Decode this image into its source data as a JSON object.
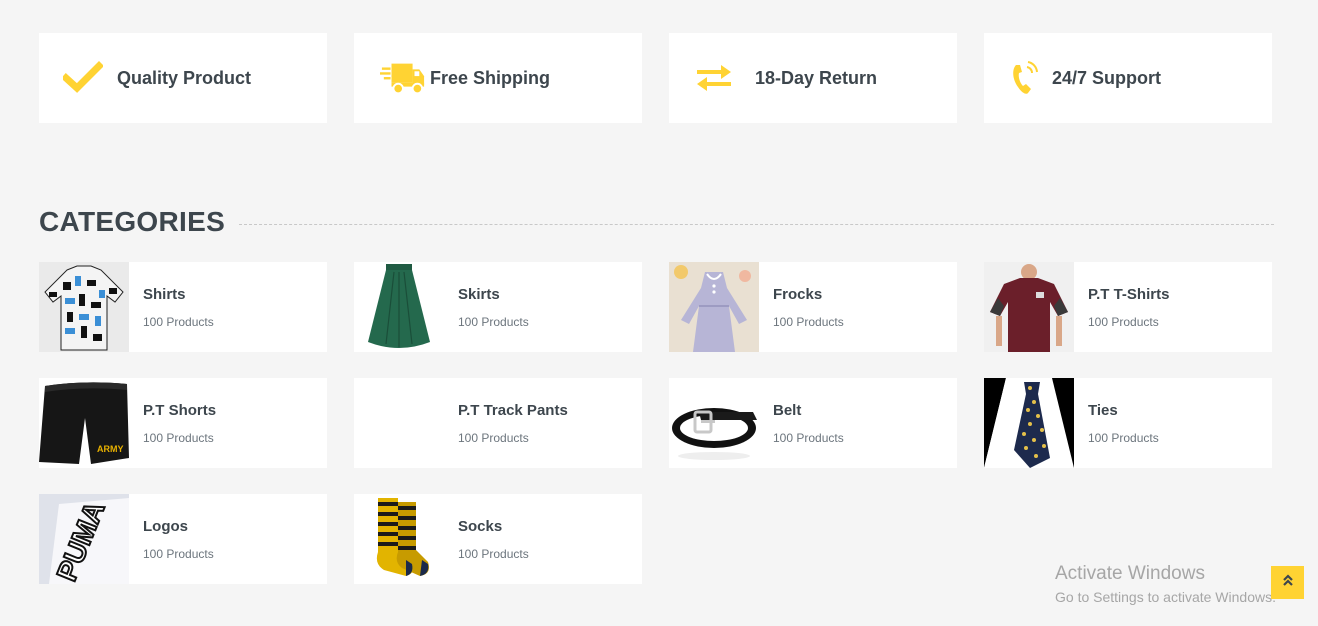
{
  "features": [
    {
      "icon": "check-icon",
      "label": "Quality Product"
    },
    {
      "icon": "truck-icon",
      "label": "Free Shipping"
    },
    {
      "icon": "exchange-icon",
      "label": "18-Day Return"
    },
    {
      "icon": "phone-icon",
      "label": "24/7 Support"
    }
  ],
  "section": {
    "title": "CATEGORIES"
  },
  "categories": [
    {
      "name": "Shirts",
      "count": "100 Products"
    },
    {
      "name": "Skirts",
      "count": "100 Products"
    },
    {
      "name": "Frocks",
      "count": "100 Products"
    },
    {
      "name": "P.T T-Shirts",
      "count": "100 Products"
    },
    {
      "name": "P.T Shorts",
      "count": "100 Products"
    },
    {
      "name": "P.T Track Pants",
      "count": "100 Products"
    },
    {
      "name": "Belt",
      "count": "100 Products"
    },
    {
      "name": "Ties",
      "count": "100 Products"
    },
    {
      "name": "Logos",
      "count": "100 Products"
    },
    {
      "name": "Socks",
      "count": "100 Products"
    }
  ],
  "shorts_print": "ARMY",
  "logo_print": "PUMA",
  "watermark": {
    "title": "Activate Windows",
    "subtitle": "Go to Settings to activate Windows."
  },
  "colors": {
    "accent": "#ffd333",
    "text": "#3d464d",
    "background": "#f5f5f5"
  }
}
